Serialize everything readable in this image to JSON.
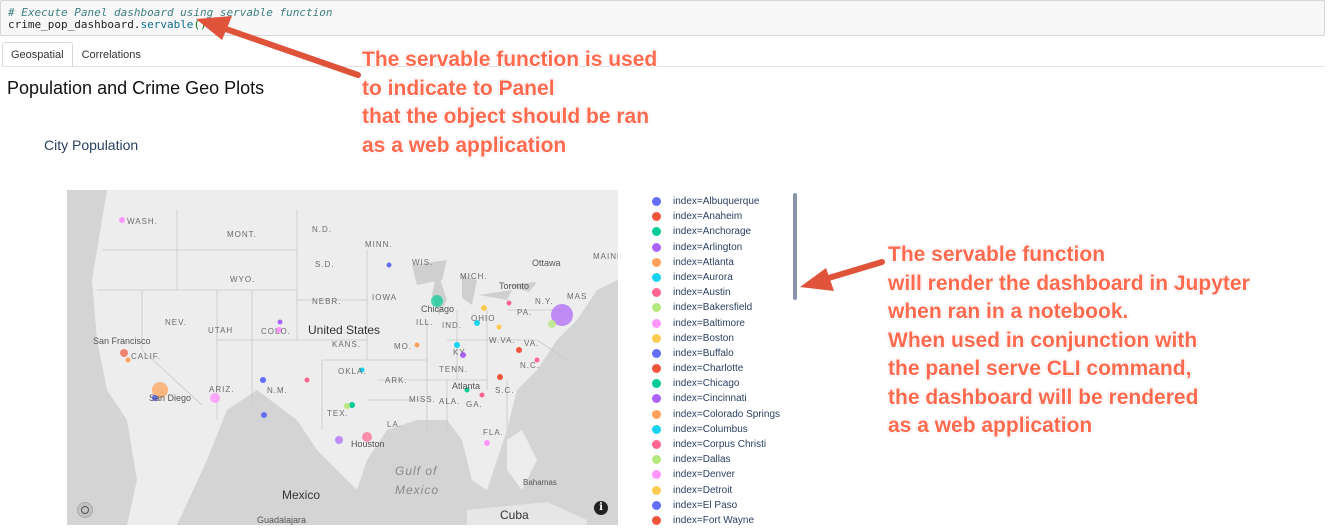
{
  "code_cell": {
    "comment": "# Execute Panel dashboard using servable function",
    "object": "crime_pop_dashboard.",
    "function": "servable",
    "parens": "()"
  },
  "tabs": [
    {
      "label": "Geospatial",
      "active": true
    },
    {
      "label": "Correlations",
      "active": false
    }
  ],
  "page_title": "Population and Crime Geo Plots",
  "plot_title": "City Population",
  "map": {
    "labels": {
      "wash": "WASH.",
      "mont": "MONT.",
      "nd": "N.D.",
      "minn": "MINN.",
      "ottawa": "Ottawa",
      "maine": "MAINE",
      "sd": "S.D.",
      "wis": "WIS.",
      "wyo": "WYO.",
      "mich": "MICH.",
      "toronto": "Toronto",
      "iowa": "IOWA",
      "nebr": "NEBR.",
      "chicago": "Chicago",
      "ny": "N.Y.",
      "mass": "MAS",
      "nev": "NEV.",
      "utah": "UTAH",
      "colo": "COLO.",
      "united_states": "United States",
      "ill": "ILL.",
      "ind": "IND.",
      "ohio": "OHIO",
      "pa": "PA.",
      "san_francisco": "San Francisco",
      "calif": "CALIF.",
      "kans": "KANS.",
      "mo": "MO.",
      "wva": "W.VA.",
      "va": "VA.",
      "ky": "KY.",
      "okla": "OKLA.",
      "nc": "N.C.",
      "tenn": "TENN.",
      "ariz": "ARIZ.",
      "nm": "N.M.",
      "ark": "ARK.",
      "atlanta": "Atlanta",
      "sc": "S.C.",
      "san_diego": "San Diego",
      "miss": "MISS.",
      "ala": "ALA.",
      "ga": "GA.",
      "tex": "TEX.",
      "la": "LA.",
      "houston": "Houston",
      "fla": "FLA.",
      "gulf": "Gulf of",
      "mexico_water": "Mexico",
      "mexico": "Mexico",
      "bahamas": "Bahamas",
      "cuba": "Cuba",
      "guadalajara": "Guadalajara"
    },
    "info_icon": "i"
  },
  "legend": [
    {
      "label": "index=Albuquerque",
      "color": "#636efa"
    },
    {
      "label": "index=Anaheim",
      "color": "#ef553b"
    },
    {
      "label": "index=Anchorage",
      "color": "#00cc96"
    },
    {
      "label": "index=Arlington",
      "color": "#ab63fa"
    },
    {
      "label": "index=Atlanta",
      "color": "#ffa15a"
    },
    {
      "label": "index=Aurora",
      "color": "#19d3f3"
    },
    {
      "label": "index=Austin",
      "color": "#ff6692"
    },
    {
      "label": "index=Bakersfield",
      "color": "#b6e880"
    },
    {
      "label": "index=Baltimore",
      "color": "#ff97ff"
    },
    {
      "label": "index=Boston",
      "color": "#fecb52"
    },
    {
      "label": "index=Buffalo",
      "color": "#636efa"
    },
    {
      "label": "index=Charlotte",
      "color": "#ef553b"
    },
    {
      "label": "index=Chicago",
      "color": "#00cc96"
    },
    {
      "label": "index=Cincinnati",
      "color": "#ab63fa"
    },
    {
      "label": "index=Colorado Springs",
      "color": "#ffa15a"
    },
    {
      "label": "index=Columbus",
      "color": "#19d3f3"
    },
    {
      "label": "index=Corpus Christi",
      "color": "#ff6692"
    },
    {
      "label": "index=Dallas",
      "color": "#b6e880"
    },
    {
      "label": "index=Denver",
      "color": "#ff97ff"
    },
    {
      "label": "index=Detroit",
      "color": "#fecb52"
    },
    {
      "label": "index=El Paso",
      "color": "#636efa"
    },
    {
      "label": "index=Fort Wayne",
      "color": "#ef553b"
    }
  ],
  "annotations": {
    "top": [
      "The servable function is used",
      "to indicate to Panel",
      "that the object should be ran",
      "as a web application"
    ],
    "right": [
      "The servable function",
      "will render the dashboard in Jupyter",
      "when ran in a notebook.",
      "When used in conjunction with",
      "the panel serve CLI command,",
      "the dashboard will be rendered",
      "as a web application"
    ],
    "color": "#ff6a4f"
  }
}
